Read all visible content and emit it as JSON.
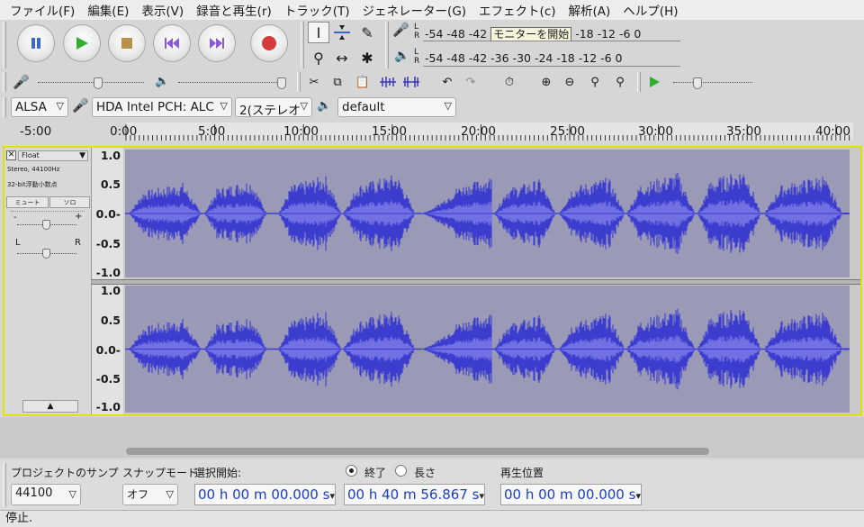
{
  "menu": [
    "ファイル(F)",
    "編集(E)",
    "表示(V)",
    "録音と再生(r)",
    "トラック(T)",
    "ジェネレーター(G)",
    "エフェクト(c)",
    "解析(A)",
    "ヘルプ(H)"
  ],
  "meters": {
    "record_scale": "-54 -48 -42",
    "record_tooltip": "モニターを開始",
    "record_scale_tail": "-18 -12 -6 0",
    "play_scale": "-54 -48 -42 -36 -30 -24 -18 -12 -6 0",
    "left_label": "L",
    "right_label": "R"
  },
  "device": {
    "host": "ALSA",
    "input_device": "HDA Intel PCH: ALC",
    "channels": "2(ステレオ",
    "output_device": "default"
  },
  "ruler_labels": [
    "-5:00",
    "0:00",
    "5:00",
    "10:00",
    "15:00",
    "20:00",
    "25:00",
    "30:00",
    "35:00",
    "40:00"
  ],
  "track": {
    "name": "Float",
    "format": "Stereo, 44100Hz",
    "bitdepth": "32-bit浮動小数点",
    "mute": "ミュート",
    "solo": "ソロ",
    "pan_left": "L",
    "pan_right": "R",
    "vruler_top": [
      "1.0",
      "0.5",
      "0.0-",
      "-0.5",
      "-1.0"
    ],
    "vruler_bottom": [
      "1.0",
      "0.5",
      "0.0-",
      "-0.5",
      "-1.0"
    ]
  },
  "selection": {
    "rate_label": "プロジェクトのサンプ",
    "rate_value": "44100",
    "snap_label": "スナップモード",
    "snap_value": "オフ",
    "start_label": "選択開始:",
    "end_label": "終了",
    "length_label": "長さ",
    "start_value": "00 h 00 m 00.000 s",
    "end_value": "00 h 40 m 56.867 s",
    "position_label": "再生位置",
    "position_value": "00 h 00 m 00.000 s"
  },
  "status": "停止.",
  "colors": {
    "wave": "#3c3ccf",
    "wave_rms": "#7171e3",
    "wave_bg": "#9a9ab7",
    "selected_border": "#e2e200"
  }
}
